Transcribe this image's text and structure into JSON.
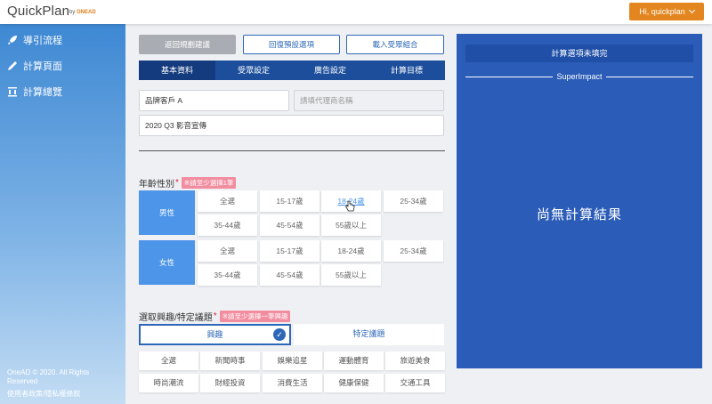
{
  "header": {
    "logo": "QuickPlan",
    "logo_by": "by",
    "logo_brand": "ONEAD",
    "user_label": "Hi, quickplan"
  },
  "sidebar": {
    "items": [
      {
        "label": "導引流程",
        "icon": "rocket-icon"
      },
      {
        "label": "計算頁面",
        "icon": "pencil-icon"
      },
      {
        "label": "計算總覽",
        "icon": "overview-icon"
      }
    ],
    "copyright": "OneAD © 2020. All Rights Reserved",
    "policy_link": "使用者政策/隱私權條款"
  },
  "actions": {
    "return": "返回規劃建議",
    "restore": "回復預設選項",
    "load": "載入受眾組合"
  },
  "tabs": [
    {
      "label": "基本資料",
      "active": true
    },
    {
      "label": "受眾設定",
      "active": false
    },
    {
      "label": "廣告設定",
      "active": false
    },
    {
      "label": "計算目標",
      "active": false
    }
  ],
  "form": {
    "client_value": "品牌客戶 A",
    "agency_placeholder": "請填代理商名稱",
    "campaign_value": "2020 Q3 影音宣傳"
  },
  "age_gender": {
    "label": "年齡性別",
    "required_mark": "*",
    "warning": "※請至少選擇1筆",
    "groups": [
      {
        "label": "男性",
        "options": [
          "全選",
          "15-17歲",
          "18-24歲",
          "25-34歲",
          "35-44歲",
          "45-54歲",
          "55歲以上"
        ]
      },
      {
        "label": "女性",
        "options": [
          "全選",
          "15-17歲",
          "18-24歲",
          "25-34歲",
          "35-44歲",
          "45-54歲",
          "55歲以上"
        ]
      }
    ],
    "hovered": "18-24歲"
  },
  "interest": {
    "label": "選取興趣/特定議題",
    "required_mark": "*",
    "warning": "※請至少選擇一筆興趣",
    "choices": [
      {
        "label": "興趣",
        "selected": true
      },
      {
        "label": "特定議題",
        "selected": false
      }
    ],
    "options": [
      "全選",
      "新聞時事",
      "娛樂追星",
      "運動體育",
      "旅遊美食",
      "時尚潮流",
      "財經投資",
      "消費生活",
      "健康保健",
      "交通工具"
    ]
  },
  "result": {
    "status": "計算選項未填完",
    "product": "SuperImpact",
    "empty": "尚無計算結果"
  },
  "colors": {
    "accent": "#2d68b8",
    "tab_bar": "#1c4e9c",
    "user_button": "#e3861f",
    "warning": "#f28da0",
    "gender_block": "#4c95e8",
    "result_panel": "#2b5cb8"
  }
}
